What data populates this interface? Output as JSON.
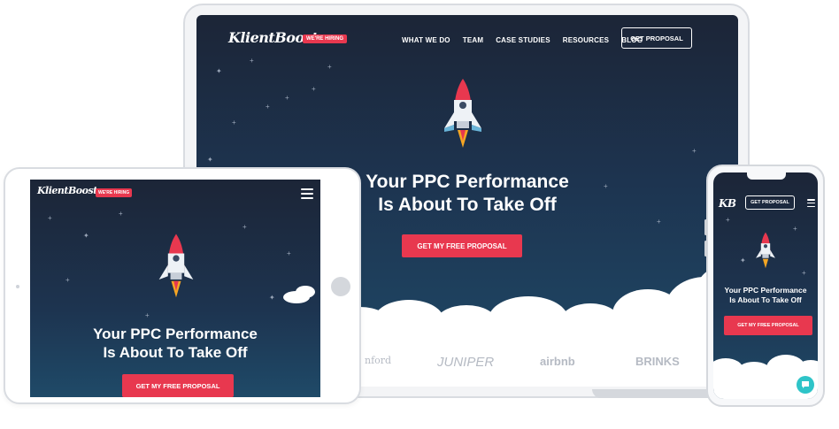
{
  "laptop": {
    "logo": "KlientBoost",
    "badge": "WE'RE HIRING",
    "nav": [
      "WHAT WE DO",
      "TEAM",
      "CASE STUDIES",
      "RESOURCES",
      "BLOG"
    ],
    "nav_cta": "GET PROPOSAL",
    "headline_line1": "Your PPC Performance",
    "headline_line2": "Is About To Take Off",
    "cta": "GET MY FREE PROPOSAL",
    "client_logos": [
      "nford",
      "JUNIPER",
      "airbnb",
      "BRINKS"
    ]
  },
  "tablet": {
    "logo": "KlientBoost",
    "badge": "WE'RE HIRING",
    "headline_line1": "Your PPC Performance",
    "headline_line2": "Is About To Take Off",
    "cta": "GET MY FREE PROPOSAL"
  },
  "phone": {
    "logo": "KB",
    "nav_cta": "GET PROPOSAL",
    "headline_line1": "Your PPC Performance",
    "headline_line2": "Is About To Take Off",
    "cta": "GET MY FREE PROPOSAL"
  },
  "colors": {
    "accent": "#e8384f",
    "sky_top": "#1c2537",
    "sky_bottom": "#1f4a68",
    "chat": "#2ec4c8"
  },
  "icons": [
    "rocket-icon",
    "hamburger-icon",
    "chat-icon",
    "cloud-icon",
    "star-icon"
  ]
}
